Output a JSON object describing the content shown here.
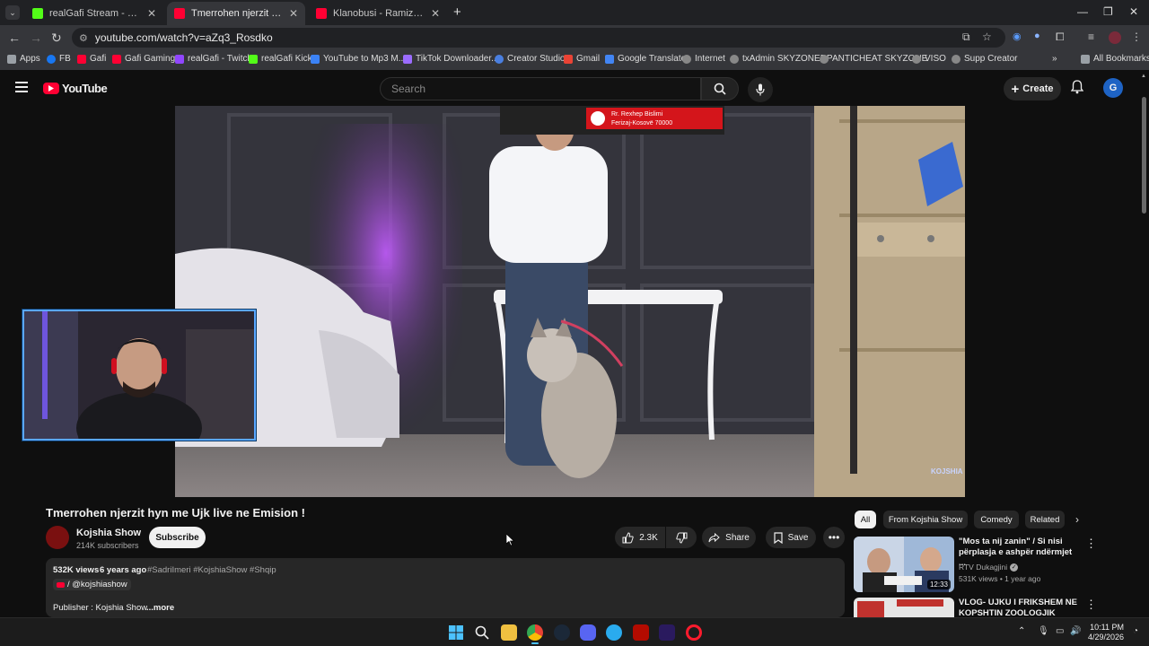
{
  "tabs": [
    {
      "title": "realGafi Stream - Watch Live o",
      "color": "#53fc18"
    },
    {
      "title": "Tmerrohen njerzit hyn me Ujk l",
      "color": "#ff0033"
    },
    {
      "title": "Klanobusi - Ramiz Tarzani bën",
      "color": "#ff0033"
    }
  ],
  "address": {
    "url": "youtube.com/watch?v=aZq3_Rosdko"
  },
  "bookmarks": [
    {
      "label": "Apps"
    },
    {
      "label": "FB"
    },
    {
      "label": "Gafi"
    },
    {
      "label": "Gafi Gaming"
    },
    {
      "label": "realGafi - Twitch"
    },
    {
      "label": "realGafi Kick"
    },
    {
      "label": "YouTube to Mp3 M..."
    },
    {
      "label": "TikTok Downloader..."
    },
    {
      "label": "Creator Studio"
    },
    {
      "label": "Gmail"
    },
    {
      "label": "Google Translate"
    },
    {
      "label": "Internet"
    },
    {
      "label": "txAdmin SKYZONERP"
    },
    {
      "label": "ANTICHEAT SKYZONE"
    },
    {
      "label": "VISO"
    },
    {
      "label": "Supp Creator"
    }
  ],
  "bookmarks_all": "All Bookmarks",
  "youtube": {
    "logo_text": "YouTube",
    "search_placeholder": "Search",
    "create_label": "Create",
    "avatar_letter": "G"
  },
  "video": {
    "title": "Tmerrohen njerzit hyn me Ujk live ne Emision !",
    "banner_line1": "Rr. Rexhep Bislimi",
    "banner_line2": "Ferizaj-Kosovë 70000",
    "watermark": "KOJSHIA"
  },
  "channel": {
    "name": "Kojshia Show",
    "subscribers": "214K subscribers",
    "subscribe_label": "Subscribe"
  },
  "actions": {
    "likes": "2.3K",
    "share": "Share",
    "save": "Save"
  },
  "description": {
    "views": "532K views",
    "age": "6 years ago",
    "tags": "#SadriImeri #KojshiaShow #Shqip",
    "handle": "/ @kojshiashow",
    "publisher": "Publisher : Kojshia Show",
    "more": "...more"
  },
  "chips": [
    "All",
    "From Kojshia Show",
    "Comedy",
    "Related"
  ],
  "related": [
    {
      "title": "\"Mos ta nij zanin\" / Si nisi përplasja e ashpër ndërmjet ...",
      "channel": "RTV Dukagjini",
      "meta": "531K views • 1 year ago",
      "duration": "12:33"
    },
    {
      "title": "VLOG- UJKU I FRIKSHEM NE KOPSHTIN ZOOLOGJIK",
      "channel": "",
      "meta": "",
      "duration": ""
    }
  ],
  "clock": {
    "time": "10:11 PM",
    "date": "4/29/2026"
  }
}
